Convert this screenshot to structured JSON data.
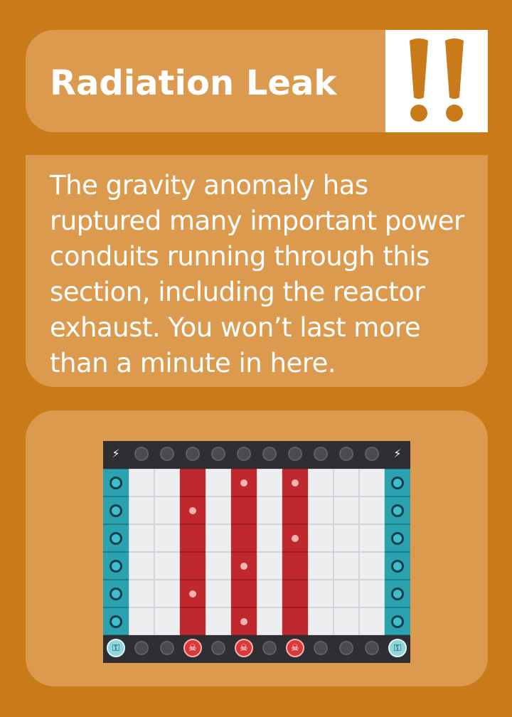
{
  "card": {
    "title": "Radiation Leak",
    "alert_icon": "double-exclamation-icon",
    "alert_color": "#c97a19",
    "description": "The gravity anomaly has ruptured many important power conduits running through this section, including the reactor exhaust. You won’t last more than a minute in here."
  },
  "colors": {
    "background": "#c97a19",
    "panel": "#dc9a4e",
    "radiation": "#c1282d",
    "port": "#2aa2b0"
  },
  "map": {
    "columns": 12,
    "rows": 8,
    "port_columns": [
      0,
      11
    ],
    "radiation_columns": [
      3,
      5,
      7
    ],
    "top_row": [
      "generator-icon",
      "bolt",
      "bolt",
      "bolt",
      "bolt",
      "bolt",
      "bolt",
      "bolt",
      "bolt",
      "bolt",
      "bolt",
      "generator-icon"
    ],
    "bottom_row": [
      "lock-icon",
      "bolt",
      "bolt",
      "skull-icon",
      "bolt",
      "skull-icon",
      "bolt",
      "skull-icon",
      "bolt",
      "bolt",
      "bolt",
      "lock-icon"
    ],
    "radiation_markers": [
      {
        "column": 3,
        "row": 2
      },
      {
        "column": 3,
        "row": 5
      },
      {
        "column": 5,
        "row": 1
      },
      {
        "column": 5,
        "row": 4
      },
      {
        "column": 5,
        "row": 6
      },
      {
        "column": 7,
        "row": 1
      },
      {
        "column": 7,
        "row": 3
      }
    ]
  }
}
